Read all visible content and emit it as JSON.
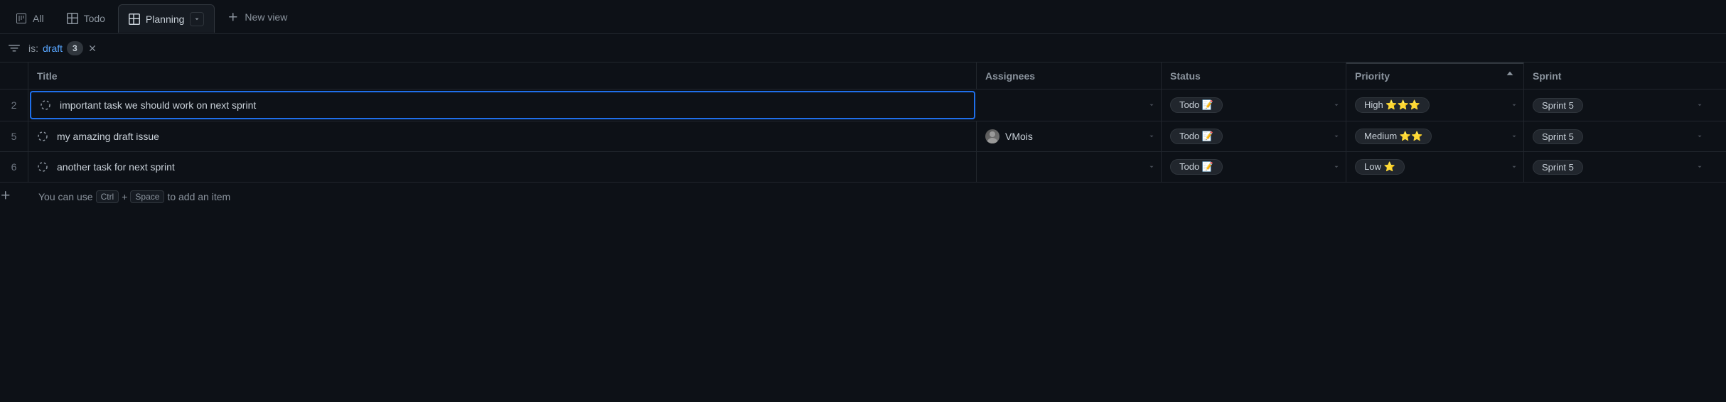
{
  "tabs": [
    {
      "label": "All"
    },
    {
      "label": "Todo"
    },
    {
      "label": "Planning"
    }
  ],
  "newView": {
    "label": "New view"
  },
  "filter": {
    "prefix": "is:",
    "value": "draft",
    "count": "3"
  },
  "headers": {
    "title": "Title",
    "assignees": "Assignees",
    "status": "Status",
    "priority": "Priority",
    "sprint": "Sprint"
  },
  "rows": [
    {
      "num": "2",
      "title": "important task we should work on next sprint",
      "assignees": "",
      "status": "Todo 📝",
      "priority": "High ⭐⭐⭐",
      "sprint": "Sprint 5",
      "selected": true
    },
    {
      "num": "5",
      "title": "my amazing draft issue",
      "assignees": "VMois",
      "status": "Todo 📝",
      "priority": "Medium ⭐⭐",
      "sprint": "Sprint 5",
      "selected": false
    },
    {
      "num": "6",
      "title": "another task for next sprint",
      "assignees": "",
      "status": "Todo 📝",
      "priority": "Low ⭐",
      "sprint": "Sprint 5",
      "selected": false
    }
  ],
  "addRow": {
    "hint1": "You can use",
    "kbd1": "Ctrl",
    "plus": "+",
    "kbd2": "Space",
    "hint2": "to add an item"
  }
}
